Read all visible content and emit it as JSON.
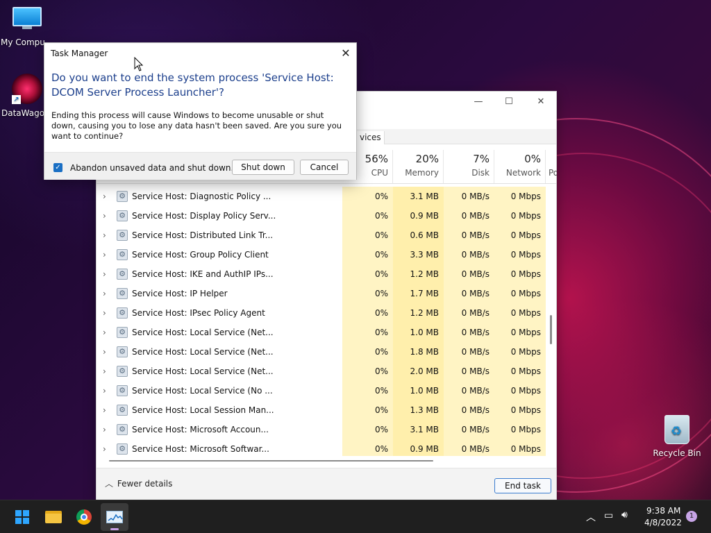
{
  "desktop": {
    "icons": [
      {
        "label": "My Computer"
      },
      {
        "label": "DataWagon"
      },
      {
        "label": "Recycle Bin"
      }
    ]
  },
  "task_manager": {
    "tab_partial": "vices",
    "columns": [
      {
        "pct": "56%",
        "label": "CPU"
      },
      {
        "pct": "20%",
        "label": "Memory"
      },
      {
        "pct": "7%",
        "label": "Disk"
      },
      {
        "pct": "0%",
        "label": "Network"
      },
      {
        "pct": "",
        "label": "Po"
      }
    ],
    "rows": [
      {
        "name": "Service Host: Diagnostic Policy ...",
        "cpu": "0%",
        "mem": "3.1 MB",
        "disk": "0 MB/s",
        "net": "0 Mbps"
      },
      {
        "name": "Service Host: Display Policy Serv...",
        "cpu": "0%",
        "mem": "0.9 MB",
        "disk": "0 MB/s",
        "net": "0 Mbps"
      },
      {
        "name": "Service Host: Distributed Link Tr...",
        "cpu": "0%",
        "mem": "0.6 MB",
        "disk": "0 MB/s",
        "net": "0 Mbps"
      },
      {
        "name": "Service Host: Group Policy Client",
        "cpu": "0%",
        "mem": "3.3 MB",
        "disk": "0 MB/s",
        "net": "0 Mbps"
      },
      {
        "name": "Service Host: IKE and AuthIP IPs...",
        "cpu": "0%",
        "mem": "1.2 MB",
        "disk": "0 MB/s",
        "net": "0 Mbps"
      },
      {
        "name": "Service Host: IP Helper",
        "cpu": "0%",
        "mem": "1.7 MB",
        "disk": "0 MB/s",
        "net": "0 Mbps"
      },
      {
        "name": "Service Host: IPsec Policy Agent",
        "cpu": "0%",
        "mem": "1.2 MB",
        "disk": "0 MB/s",
        "net": "0 Mbps"
      },
      {
        "name": "Service Host: Local Service (Net...",
        "cpu": "0%",
        "mem": "1.0 MB",
        "disk": "0 MB/s",
        "net": "0 Mbps"
      },
      {
        "name": "Service Host: Local Service (Net...",
        "cpu": "0%",
        "mem": "1.8 MB",
        "disk": "0 MB/s",
        "net": "0 Mbps"
      },
      {
        "name": "Service Host: Local Service (Net...",
        "cpu": "0%",
        "mem": "2.0 MB",
        "disk": "0 MB/s",
        "net": "0 Mbps"
      },
      {
        "name": "Service Host: Local Service (No ...",
        "cpu": "0%",
        "mem": "1.0 MB",
        "disk": "0 MB/s",
        "net": "0 Mbps"
      },
      {
        "name": "Service Host: Local Session Man...",
        "cpu": "0%",
        "mem": "1.3 MB",
        "disk": "0 MB/s",
        "net": "0 Mbps"
      },
      {
        "name": "Service Host: Microsoft Accoun...",
        "cpu": "0%",
        "mem": "3.1 MB",
        "disk": "0 MB/s",
        "net": "0 Mbps"
      },
      {
        "name": "Service Host: Microsoft Softwar...",
        "cpu": "0%",
        "mem": "0.9 MB",
        "disk": "0 MB/s",
        "net": "0 Mbps"
      }
    ],
    "fewer_details": "Fewer details",
    "end_task": "End task"
  },
  "dialog": {
    "title": "Task Manager",
    "heading": "Do you want to end the system process 'Service Host: DCOM Server Process Launcher'?",
    "body": "Ending this process will cause Windows to become unusable or shut down, causing you to lose any data hasn't been saved. Are you sure you want to continue?",
    "checkbox_label": "Abandon unsaved data and shut down.",
    "checkbox_checked": true,
    "shutdown_label": "Shut down",
    "cancel_label": "Cancel"
  },
  "taskbar": {
    "time": "9:38 AM",
    "date": "4/8/2022",
    "notification_count": "1"
  },
  "colors": {
    "accent": "#1a6fc4",
    "heading_blue": "#1c3f8c",
    "heat_light": "#fff4c4",
    "heat_medium": "#ffefac"
  }
}
